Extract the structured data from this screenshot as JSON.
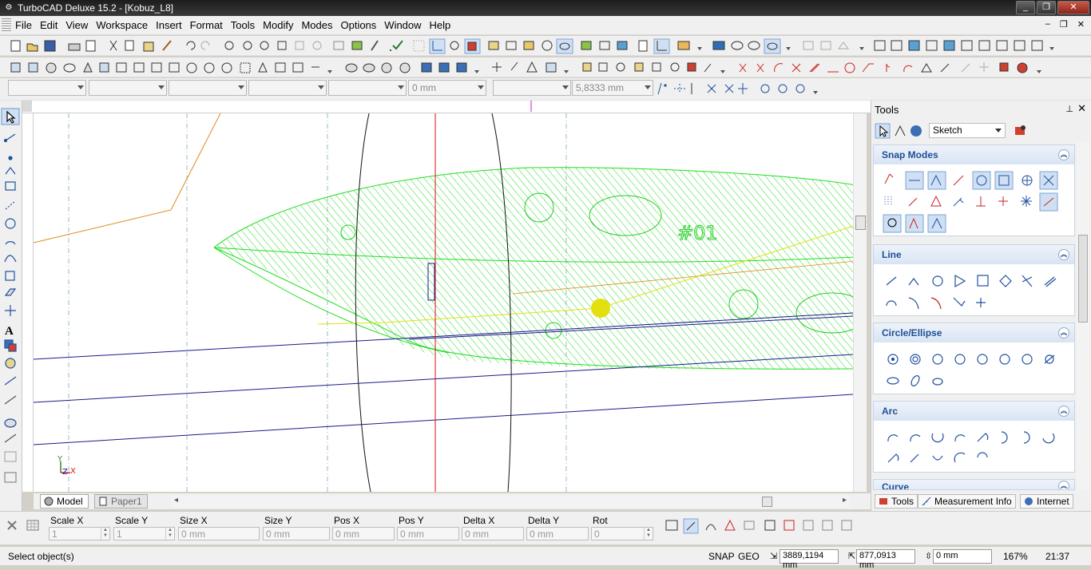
{
  "window": {
    "title": "TurboCAD Deluxe 15.2 - [Kobuz_L8]",
    "buttons": [
      "_",
      "❐",
      "✕"
    ]
  },
  "menu": {
    "items": [
      "File",
      "Edit",
      "View",
      "Workspace",
      "Insert",
      "Format",
      "Tools",
      "Modify",
      "Modes",
      "Options",
      "Window",
      "Help"
    ],
    "doc_controls": [
      "–",
      "❐",
      "✕"
    ]
  },
  "property_bar": {
    "combo_a": "",
    "combo_b": "",
    "combo_c": "",
    "combo_d": "",
    "combo_e": "",
    "width_value": "0 mm",
    "combo_f": "",
    "text_size_value": "5,8333 mm"
  },
  "drawing": {
    "label": "#01",
    "colors": {
      "hatch": "#22dd22",
      "blue_line": "#1a1a8c",
      "red_line": "#d61010",
      "orange_line": "#e08a1a",
      "yellow_marker": "#e4e010",
      "black_curve": "#111111"
    }
  },
  "ucs_icon": {
    "y": "Y",
    "z": "Z",
    "x": "X"
  },
  "sheet_tabs": [
    {
      "label": "Model",
      "active": true
    },
    {
      "label": "Paper1",
      "active": false
    }
  ],
  "inspector": {
    "fields": [
      {
        "label": "Scale X",
        "value": "1"
      },
      {
        "label": "Scale Y",
        "value": "1"
      },
      {
        "label": "Size X",
        "value": "0 mm"
      },
      {
        "label": "Size Y",
        "value": "0 mm"
      },
      {
        "label": "Pos X",
        "value": "0 mm"
      },
      {
        "label": "Pos Y",
        "value": "0 mm"
      },
      {
        "label": "Delta X",
        "value": "0 mm"
      },
      {
        "label": "Delta Y",
        "value": "0 mm"
      },
      {
        "label": "Rot",
        "value": "0"
      }
    ]
  },
  "status": {
    "prompt": "Select object(s)",
    "snap": "SNAP",
    "geo": "GEO",
    "coord_x": "3889,1194 mm",
    "coord_y": "877,0913 mm",
    "coord_z": "0 mm",
    "zoom": "167%",
    "time": "21:37"
  },
  "tools_panel": {
    "title": "Tools",
    "mode_select": "Sketch",
    "sections": [
      {
        "title": "Snap Modes"
      },
      {
        "title": "Line"
      },
      {
        "title": "Circle/Ellipse"
      },
      {
        "title": "Arc"
      },
      {
        "title": "Curve"
      }
    ],
    "bottom_tabs": [
      "Tools",
      "Measurement Info",
      "Internet"
    ]
  }
}
